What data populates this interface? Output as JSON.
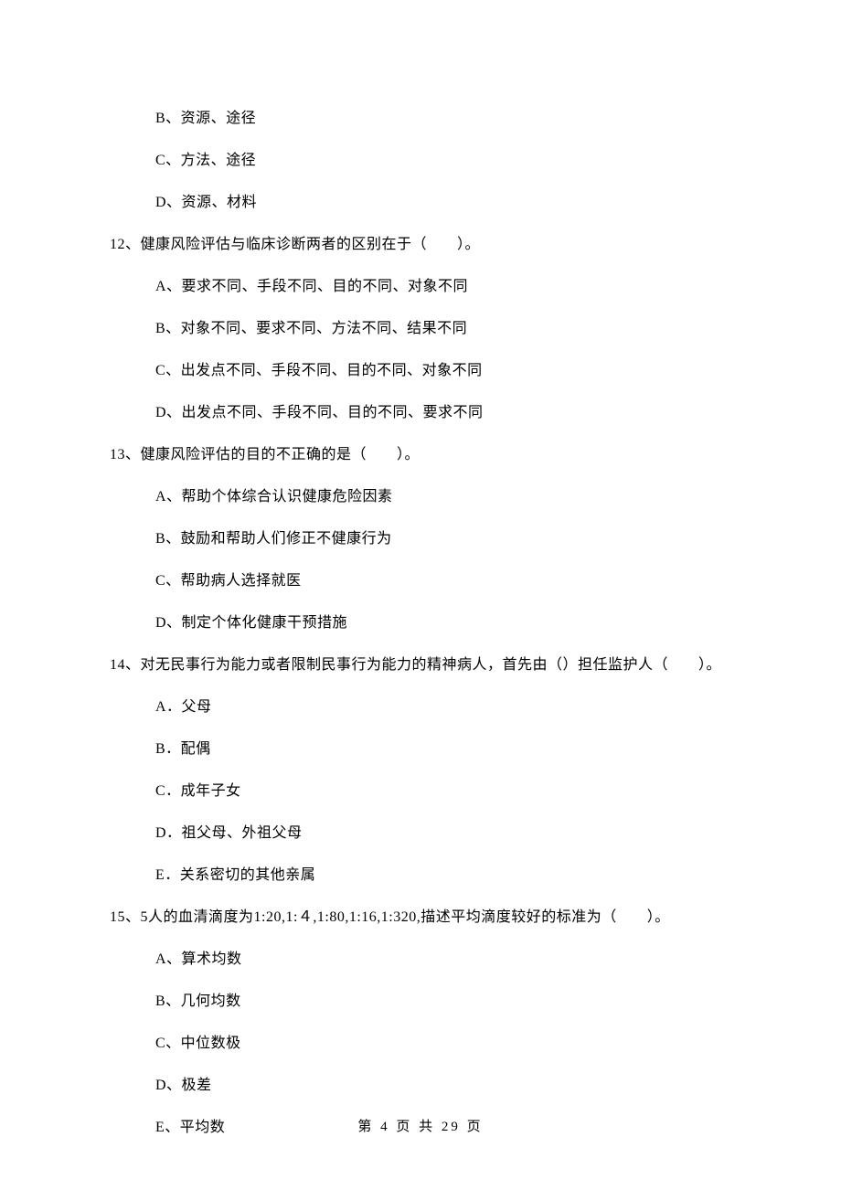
{
  "options_top": [
    "B、资源、途径",
    "C、方法、途径",
    "D、资源、材料"
  ],
  "q12": {
    "text": "12、健康风险评估与临床诊断两者的区别在于（　　）。",
    "options": [
      "A、要求不同、手段不同、目的不同、对象不同",
      "B、对象不同、要求不同、方法不同、结果不同",
      "C、出发点不同、手段不同、目的不同、对象不同",
      "D、出发点不同、手段不同、目的不同、要求不同"
    ]
  },
  "q13": {
    "text": "13、健康风险评估的目的不正确的是（　　）。",
    "options": [
      "A、帮助个体综合认识健康危险因素",
      "B、鼓励和帮助人们修正不健康行为",
      "C、帮助病人选择就医",
      "D、制定个体化健康干预措施"
    ]
  },
  "q14": {
    "text": "14、对无民事行为能力或者限制民事行为能力的精神病人，首先由（）担任监护人（　　）。",
    "options": [
      "A．父母",
      "B．配偶",
      "C．成年子女",
      "D．祖父母、外祖父母",
      "E．关系密切的其他亲属"
    ]
  },
  "q15": {
    "text": "15、5人的血清滴度为1:20,1:４,1:80,1:16,1:320,描述平均滴度较好的标准为（　　）。",
    "options": [
      "A、算术均数",
      "B、几何均数",
      "C、中位数极",
      "D、极差",
      "E、平均数"
    ]
  },
  "footer": "第 4 页 共 29 页"
}
